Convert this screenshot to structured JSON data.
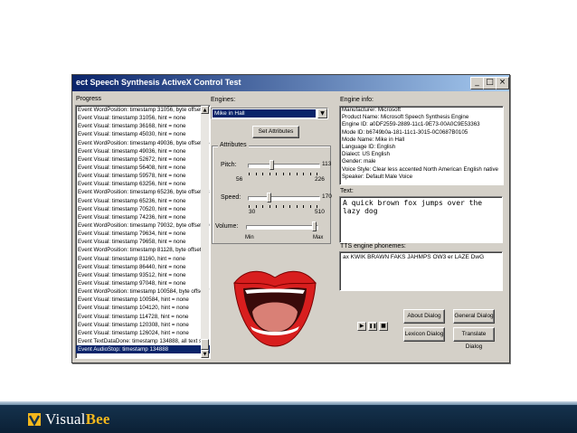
{
  "window": {
    "title": "ect Speech Synthesis ActiveX Control Test",
    "min_label": "_",
    "max_label": "□",
    "close_label": "×"
  },
  "progress": {
    "label": "Progress",
    "lines": [
      "Event WordPosition: timestamp 31056, byte offset 28",
      "Event Visual: timestamp 31056, hint = none",
      "Event Visual: timestamp 36168, hint = none",
      "Event Visual: timestamp 45030, hint = none",
      "Event WordPosition: timestamp 49036, byte offset 36",
      "Event Visual: timestamp 49036, hint = none",
      "Event Visual: timestamp 52672, hint = none",
      "Event Visual: timestamp 56408, hint = none",
      "Event Visual: timestamp 59578, hint = none",
      "Event Visual: timestamp 63256, hint = none",
      "Event WordPosition: timestamp 65236, byte offset 48",
      "Event Visual: timestamp 65236, hint = none",
      "Event Visual: timestamp 70520, hint = none",
      "Event Visual: timestamp 74236, hint = none",
      "Event WordPosition: timestamp 79032, byte offset 50",
      "Event Visual: timestamp 79634, hint = none",
      "Event Visual: timestamp 79658, hint = none",
      "Event WordPosition: timestamp 81128, byte offset 68",
      "Event Visual: timestamp 81160, hint = none",
      "Event Visual: timestamp 86440, hint = none",
      "Event Visual: timestamp 93512, hint = none",
      "Event Visual: timestamp 97048, hint = none",
      "Event WordPosition: timestamp 100584, byte offset 7",
      "Event Visual: timestamp 100584, hint = none",
      "Event Visual: timestamp 104120, hint = none",
      "Event Visual: timestamp 114728, hint = none",
      "Event Visual: timestamp 120308, hint = none",
      "Event Visual: timestamp 126024, hint = none",
      "Event TextDataDone: timestamp 134888, all text sen",
      "Event AudioStop: timestamp 134888"
    ],
    "selected_index": 29
  },
  "engines": {
    "label": "Engines:",
    "selected": "Mike in Hall",
    "set_attributes_label": "Set Attributes"
  },
  "attributes": {
    "title": "Attributes",
    "pitch_label": "Pitch:",
    "pitch_value": "113",
    "pitch_min": "56",
    "pitch_max": "226",
    "pitch_level": 0.33,
    "speed_label": "Speed:",
    "speed_value": "170",
    "speed_min": "30",
    "speed_max": "510",
    "speed_level": 0.29,
    "volume_label": "Volume:",
    "volume_min": "Min",
    "volume_max": "Max",
    "volume_level": 1.0
  },
  "engine_info": {
    "label": "Engine info:",
    "lines": [
      "Manufacturer: Microsoft",
      "Product Name: Microsoft Speech Synthesis Engine",
      "Engine ID: a0DF2559-2889-11c1-9E73-00A0C9E53363",
      "Mode ID: b6749b0a-181-11c1-3015-0C0687B0105",
      "Mode Name: Mike in Hall",
      "Language ID: English",
      "Dialect: US English",
      "Gender: male",
      "Voice Style: Clear less accented North American English native",
      "Speaker: Default Male Voice"
    ]
  },
  "text": {
    "label": "Text:",
    "value": "A quick brown fox jumps over the lazy dog"
  },
  "phonemes": {
    "label": "TTS engine phonemes:",
    "value": "ax KWIK BRAWN FAKS JAHMPS OW3 er LAZE DwG"
  },
  "controls": {
    "play": "▶",
    "pause": "❚❚",
    "stop": "■",
    "about_label": "About Dialog",
    "general_label": "General Dialog",
    "lexicon_label": "Lexicon Dialog",
    "translate_label": "Translate Dialog"
  },
  "brand": {
    "name_part1": "Visual",
    "name_part2": "Bee"
  },
  "colors": {
    "lips": "#d81e1e",
    "tongue": "#d98076",
    "accent": "#0a246a"
  }
}
